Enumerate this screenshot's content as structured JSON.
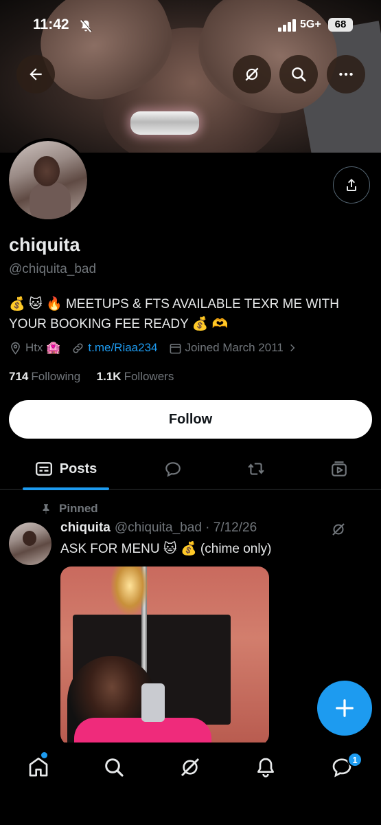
{
  "status_bar": {
    "time": "11:42",
    "network": "5G+",
    "battery": "68"
  },
  "profile": {
    "name": "chiquita",
    "handle": "@chiquita_bad",
    "bio": "💰 🐱 🔥 MEETUPS & FTS AVAILABLE TEXR ME WITH YOUR BOOKING FEE READY 💰 🫶",
    "location": "Htx 🏩",
    "link": "t.me/Riaa234",
    "joined": "Joined March 2011",
    "following_count": "714",
    "following_label": "Following",
    "followers_count": "1.1K",
    "followers_label": "Followers",
    "follow_button": "Follow"
  },
  "tabs": [
    {
      "label": "Posts",
      "icon": "posts-icon",
      "active": true
    },
    {
      "label": "",
      "icon": "replies-icon"
    },
    {
      "label": "",
      "icon": "reposts-icon"
    },
    {
      "label": "",
      "icon": "media-icon"
    }
  ],
  "pinned_post": {
    "pinned_label": "Pinned",
    "author": "chiquita",
    "handle_date": "@chiquita_bad · 7/12/26",
    "text": "ASK FOR MENU 🐱 💰 (chime only)"
  },
  "bottom_nav": {
    "items": [
      "home-icon",
      "search-icon",
      "grok-icon",
      "notifications-icon",
      "messages-icon"
    ],
    "messages_badge": "1"
  },
  "colors": {
    "accent": "#1d9bf0",
    "muted": "#71767b",
    "text": "#e7e9ea",
    "background": "#000000"
  }
}
